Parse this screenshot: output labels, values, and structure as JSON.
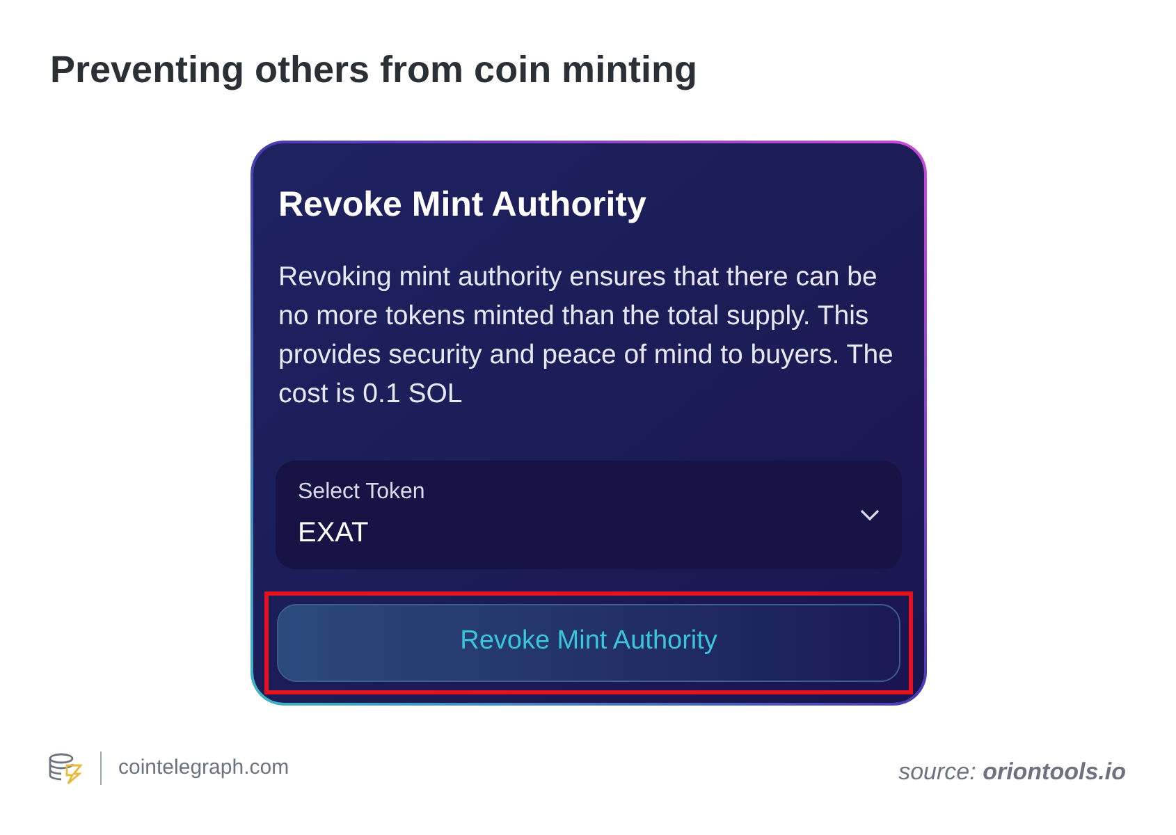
{
  "heading": "Preventing others from coin minting",
  "card": {
    "title": "Revoke Mint Authority",
    "description": "Revoking mint authority ensures that there can be no more tokens minted than the total supply. This provides security and peace of mind to buyers. The cost is 0.1 SOL",
    "select": {
      "label": "Select Token",
      "value": "EXAT"
    },
    "button": {
      "label": "Revoke Mint Authority",
      "highlighted": true
    }
  },
  "footer": {
    "site": "cointelegraph.com",
    "source": "source: **oriontools.io**"
  }
}
